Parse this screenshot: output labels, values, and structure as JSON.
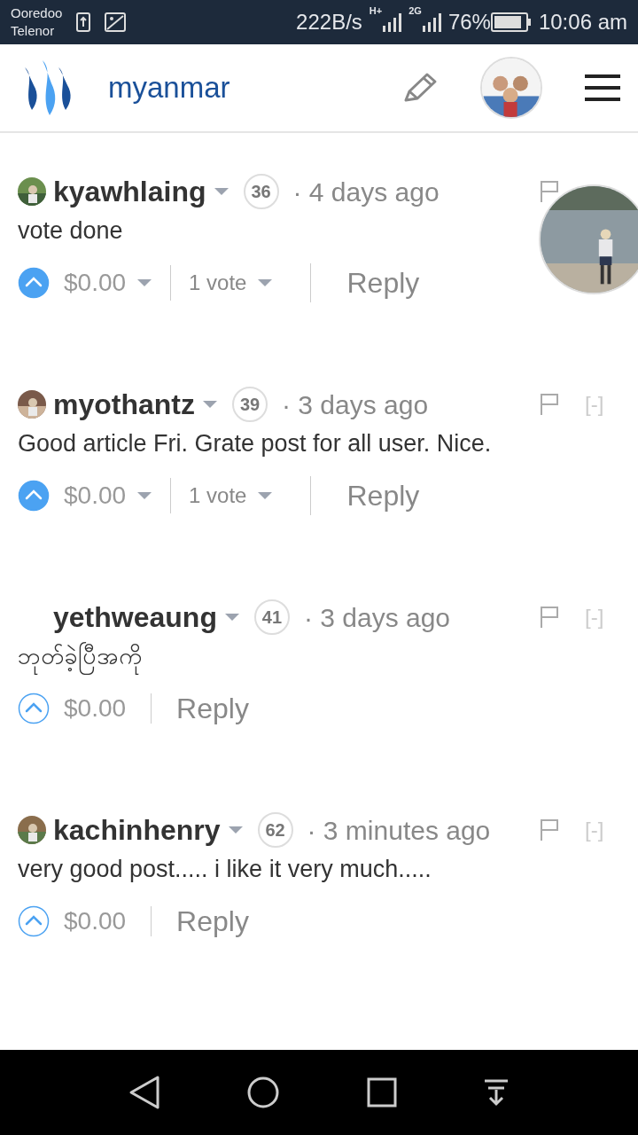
{
  "status_bar": {
    "carriers": [
      "Ooredoo",
      "Telenor"
    ],
    "speed": "222B/s",
    "network_1": "H+",
    "network_2": "2G",
    "battery": "76%",
    "time": "10:06 am"
  },
  "header": {
    "title": "myanmar"
  },
  "comments": [
    {
      "author": "kyawhlaing",
      "has_avatar": true,
      "reputation": "36",
      "time": "· 4 days ago",
      "body": "vote done",
      "voted": true,
      "payout": "$0.00",
      "votes": "1 vote",
      "reply": "Reply"
    },
    {
      "author": "myothantz",
      "has_avatar": true,
      "reputation": "39",
      "time": "· 3 days ago",
      "collapse": "[-]",
      "body": "Good article Fri. Grate post for all user. Nice.",
      "voted": true,
      "payout": "$0.00",
      "votes": "1 vote",
      "reply": "Reply"
    },
    {
      "author": "yethweaung",
      "has_avatar": false,
      "reputation": "41",
      "time": "· 3 days ago",
      "collapse": "[-]",
      "body": "ဘုတ်ခဲ့ပြီအကို",
      "voted": false,
      "payout": "$0.00",
      "reply": "Reply"
    },
    {
      "author": "kachinhenry",
      "has_avatar": true,
      "reputation": "62",
      "time": "· 3 minutes ago",
      "collapse": "[-]",
      "body": "very good post..... i like it very much.....",
      "voted": false,
      "payout": "$0.00",
      "reply": "Reply"
    }
  ]
}
